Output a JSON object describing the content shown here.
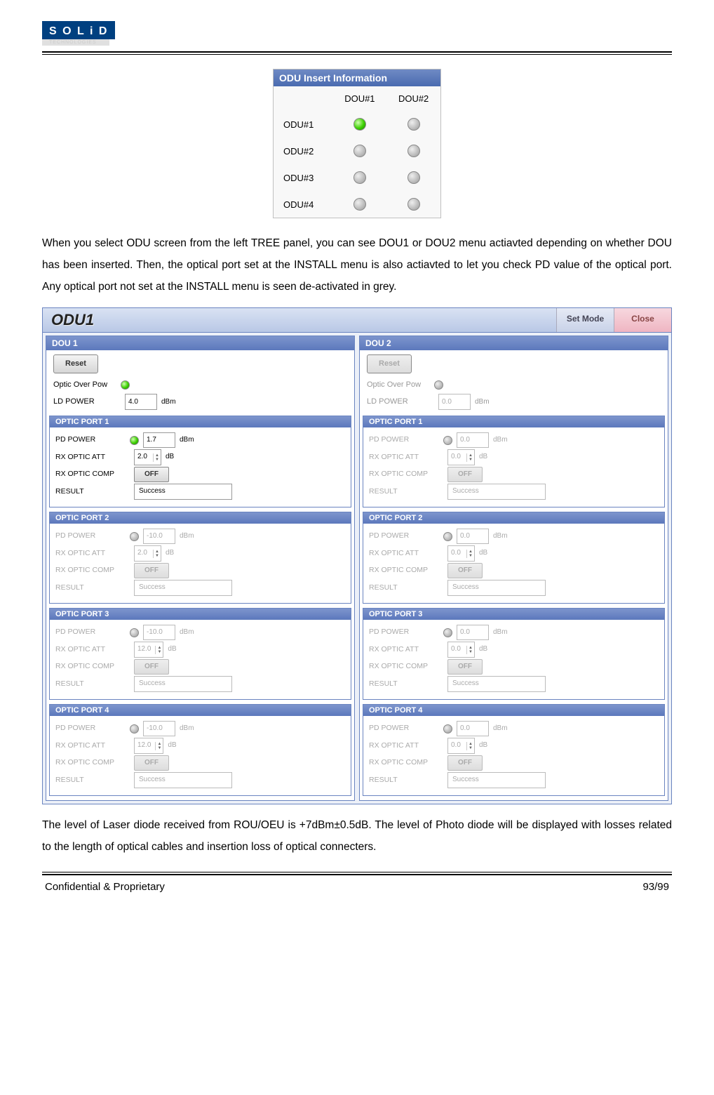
{
  "logo": {
    "main": "S O L i D",
    "sub": "TECHNOLOGIES"
  },
  "insert_panel": {
    "title": "ODU Insert Information",
    "cols": [
      "DOU#1",
      "DOU#2"
    ],
    "rows": [
      {
        "label": "ODU#1",
        "states": [
          "green",
          "grey"
        ]
      },
      {
        "label": "ODU#2",
        "states": [
          "grey",
          "grey"
        ]
      },
      {
        "label": "ODU#3",
        "states": [
          "grey",
          "grey"
        ]
      },
      {
        "label": "ODU#4",
        "states": [
          "grey",
          "grey"
        ]
      }
    ]
  },
  "para1": "When you select ODU screen from the left TREE panel, you can see DOU1 or DOU2 menu actiavted depending on whether DOU has been inserted. Then, the optical port set at the INSTALL menu is also actiavted to let you check PD value of the optical port. Any optical port not set at the INSTALL menu is seen de-activated in grey.",
  "odu": {
    "title": "ODU1",
    "set_mode": "Set Mode",
    "close": "Close",
    "labels": {
      "reset": "Reset",
      "optic_over_pow": "Optic Over Pow",
      "ld_power": "LD POWER",
      "pd_power": "PD POWER",
      "rx_optic_att": "RX OPTIC ATT",
      "rx_optic_comp": "RX OPTIC COMP",
      "result": "RESULT",
      "off": "OFF",
      "dbm": "dBm",
      "db": "dB"
    },
    "dou": [
      {
        "title": "DOU 1",
        "active": true,
        "optic_over_pow_led": "green",
        "ld_power": "4.0",
        "ports": [
          {
            "title": "OPTIC PORT 1",
            "active": true,
            "led": "green",
            "pd": "1.7",
            "att": "2.0",
            "result": "Success"
          },
          {
            "title": "OPTIC PORT 2",
            "active": false,
            "led": "grey",
            "pd": "-10.0",
            "att": "2.0",
            "result": "Success"
          },
          {
            "title": "OPTIC PORT 3",
            "active": false,
            "led": "grey",
            "pd": "-10.0",
            "att": "12.0",
            "result": "Success"
          },
          {
            "title": "OPTIC PORT 4",
            "active": false,
            "led": "grey",
            "pd": "-10.0",
            "att": "12.0",
            "result": "Success"
          }
        ]
      },
      {
        "title": "DOU 2",
        "active": false,
        "optic_over_pow_led": "grey",
        "ld_power": "0.0",
        "ports": [
          {
            "title": "OPTIC PORT 1",
            "active": false,
            "led": "grey",
            "pd": "0.0",
            "att": "0.0",
            "result": "Success"
          },
          {
            "title": "OPTIC PORT 2",
            "active": false,
            "led": "grey",
            "pd": "0.0",
            "att": "0.0",
            "result": "Success"
          },
          {
            "title": "OPTIC PORT 3",
            "active": false,
            "led": "grey",
            "pd": "0.0",
            "att": "0.0",
            "result": "Success"
          },
          {
            "title": "OPTIC PORT 4",
            "active": false,
            "led": "grey",
            "pd": "0.0",
            "att": "0.0",
            "result": "Success"
          }
        ]
      }
    ]
  },
  "para2": "The level of Laser diode received from ROU/OEU is +7dBm±0.5dB. The level of Photo diode will be displayed with losses related to the length of optical cables and insertion loss of optical connecters.",
  "footer": {
    "left": "Confidential & Proprietary",
    "right": "93/99"
  }
}
